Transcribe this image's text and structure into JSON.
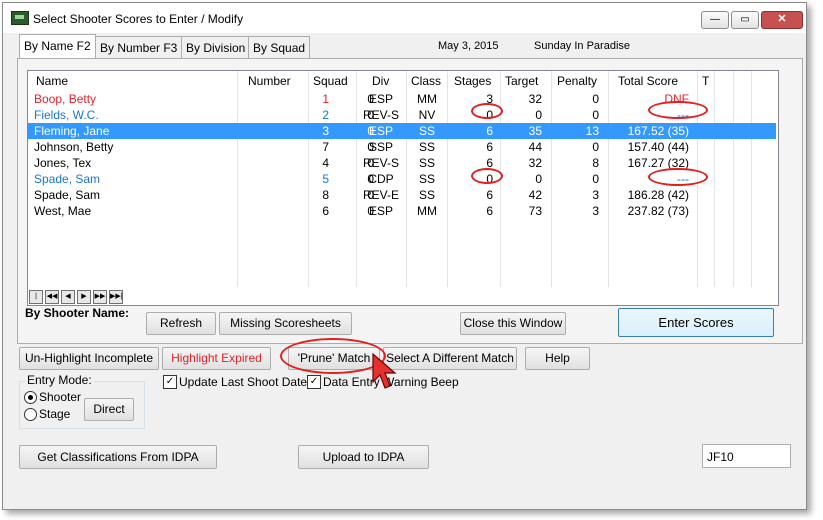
{
  "window": {
    "title": "Select Shooter Scores to Enter / Modify",
    "minimize": "—",
    "maximize": "▭",
    "close": "✕"
  },
  "tabs": [
    {
      "label": "By Name F2",
      "active": true
    },
    {
      "label": "By Number F3",
      "active": false
    },
    {
      "label": "By Division",
      "active": false
    },
    {
      "label": "By Squad",
      "active": false
    }
  ],
  "match": {
    "date": "May  3, 2015",
    "name": "Sunday In Paradise"
  },
  "grid": {
    "columns": [
      "Name",
      "Number",
      "Squad",
      "Div",
      "Class",
      "Stages",
      "Target",
      "Penalty",
      "Total Score",
      "T"
    ],
    "rows": [
      {
        "name": "Boop, Betty",
        "number": "1",
        "squad": "0",
        "div": "ESP",
        "class": "MM",
        "stages": "3",
        "target": "32",
        "penalty": "0",
        "total": "DNF",
        "style": "red"
      },
      {
        "name": "Fields, W.C.",
        "number": "2",
        "squad": "0",
        "div": "REV-S",
        "class": "NV",
        "stages": "0",
        "target": "0",
        "penalty": "0",
        "total": "---",
        "style": "blue"
      },
      {
        "name": "Fleming, Jane",
        "number": "3",
        "squad": "0",
        "div": "ESP",
        "class": "SS",
        "stages": "6",
        "target": "35",
        "penalty": "13",
        "total": "167.52 (35)",
        "style": "selected"
      },
      {
        "name": "Johnson, Betty",
        "number": "7",
        "squad": "0",
        "div": "SSP",
        "class": "SS",
        "stages": "6",
        "target": "44",
        "penalty": "0",
        "total": "157.40 (44)",
        "style": "normal"
      },
      {
        "name": "Jones, Tex",
        "number": "4",
        "squad": "0",
        "div": "REV-S",
        "class": "SS",
        "stages": "6",
        "target": "32",
        "penalty": "8",
        "total": "167.27 (32)",
        "style": "normal"
      },
      {
        "name": "Spade, Sam",
        "number": "5",
        "squad": "0",
        "div": "CDP",
        "class": "SS",
        "stages": "0",
        "target": "0",
        "penalty": "0",
        "total": "---",
        "style": "blue"
      },
      {
        "name": "Spade, Sam",
        "number": "8",
        "squad": "0",
        "div": "REV-E",
        "class": "SS",
        "stages": "6",
        "target": "42",
        "penalty": "3",
        "total": "186.28 (42)",
        "style": "normal"
      },
      {
        "name": "West, Mae",
        "number": "6",
        "squad": "0",
        "div": "ESP",
        "class": "MM",
        "stages": "6",
        "target": "73",
        "penalty": "3",
        "total": "237.82 (73)",
        "style": "normal"
      }
    ],
    "navigator": [
      "first-page",
      "prev-page",
      "prev-record",
      "next-record",
      "next-page",
      "last-page"
    ]
  },
  "by_shooter_label": "By Shooter Name:",
  "buttons": {
    "refresh": "Refresh",
    "missing": "Missing Scoresheets",
    "close_window": "Close this Window",
    "enter_scores": "Enter Scores",
    "unhighlight": "Un-Highlight Incomplete",
    "highlight_expired": "Highlight Expired",
    "prune": "'Prune' Match",
    "select_match": "Select A Different  Match",
    "help": "Help",
    "direct": "Direct",
    "get_class": "Get Classifications From IDPA",
    "upload": "Upload to IDPA"
  },
  "entry_mode": {
    "label": "Entry Mode:",
    "shooter": "Shooter",
    "stage": "Stage",
    "selected": "Shooter"
  },
  "checkboxes": {
    "update_last": "Update Last Shoot Date",
    "warning_beep": "Data Entry Warning Beep"
  },
  "code_field": "JF10",
  "colors": {
    "red": "#e8202a",
    "blue": "#1a73d8",
    "selected": "#3399ff",
    "annotation": "#e02020"
  }
}
